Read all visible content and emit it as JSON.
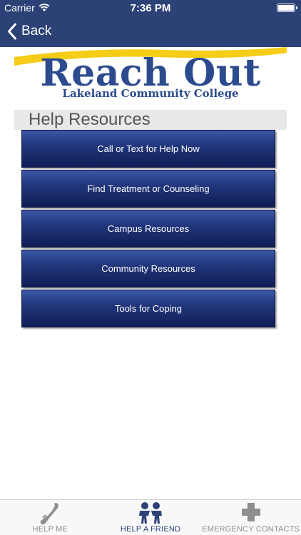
{
  "status_bar": {
    "carrier": "Carrier",
    "time": "7:36 PM"
  },
  "nav": {
    "back_label": "Back"
  },
  "banner": {
    "title": "Reach Out",
    "subtitle": "Lakeland Community College"
  },
  "section": {
    "title": "Help Resources"
  },
  "menu_items": [
    {
      "label": "Call or Text for Help Now"
    },
    {
      "label": "Find Treatment or Counseling"
    },
    {
      "label": "Campus Resources"
    },
    {
      "label": "Community Resources"
    },
    {
      "label": "Tools for Coping"
    }
  ],
  "tabs": [
    {
      "label": "HELP ME",
      "icon": "helping-hands-icon"
    },
    {
      "label": "HELP A FRIEND",
      "icon": "friends-icon",
      "active": true
    },
    {
      "label": "EMERGENCY CONTACTS",
      "icon": "medical-cross-icon"
    }
  ],
  "colors": {
    "nav_bar": "#2c4277",
    "button_top": "#3b57a6",
    "button_bottom": "#0e1d56",
    "logo_blue": "#2c4a8e",
    "swoosh_yellow": "#f5cc16"
  }
}
